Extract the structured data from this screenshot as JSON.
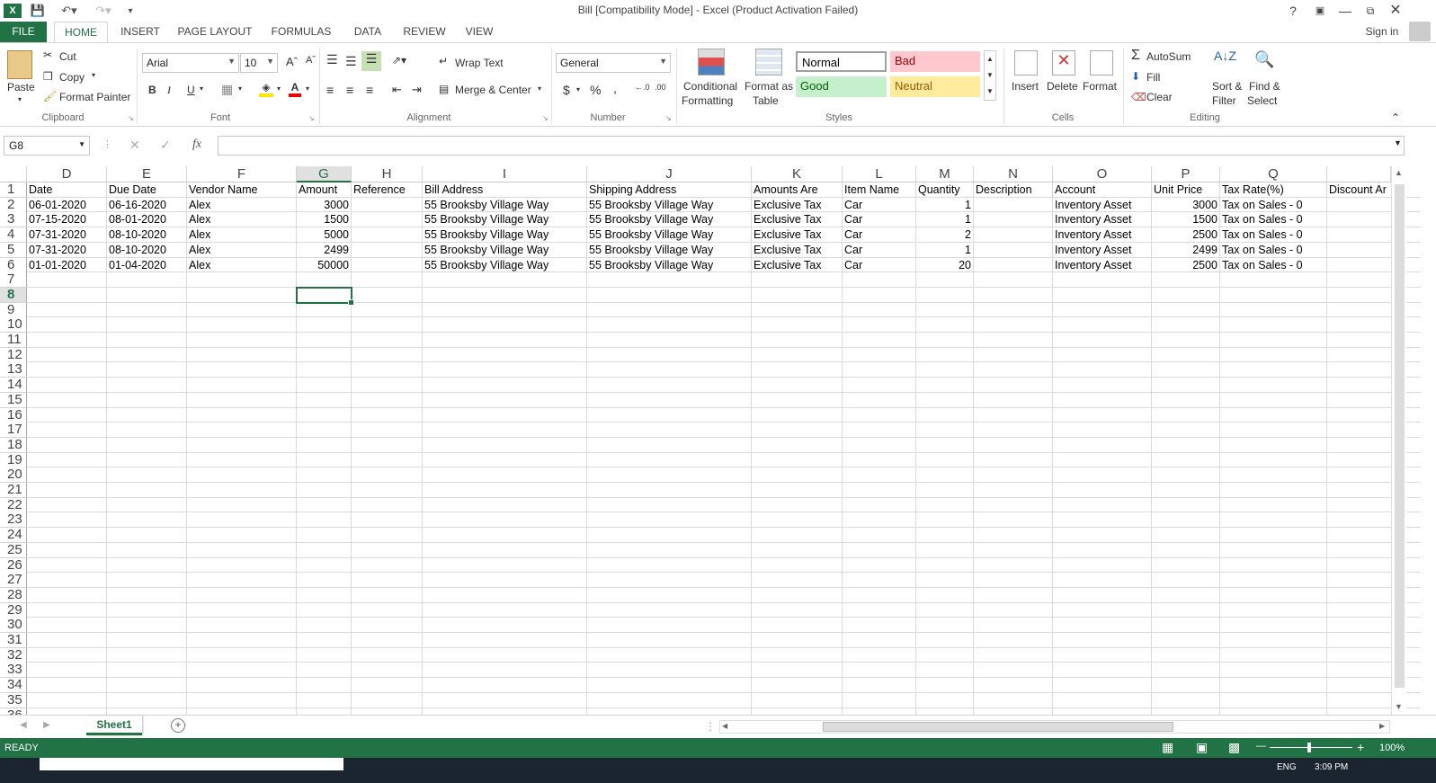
{
  "window": {
    "title": "Bill  [Compatibility Mode] - Excel (Product Activation Failed)",
    "help": "?",
    "sign_in": "Sign in"
  },
  "tabs": [
    "FILE",
    "HOME",
    "INSERT",
    "PAGE LAYOUT",
    "FORMULAS",
    "DATA",
    "REVIEW",
    "VIEW"
  ],
  "ribbon": {
    "clipboard": {
      "paste": "Paste",
      "cut": "Cut",
      "copy": "Copy",
      "format_painter": "Format Painter",
      "label": "Clipboard"
    },
    "font": {
      "name": "Arial",
      "size": "10",
      "label": "Font",
      "bold": "B",
      "italic": "I",
      "underline": "U"
    },
    "alignment": {
      "wrap_text": "Wrap Text",
      "merge_center": "Merge & Center",
      "label": "Alignment"
    },
    "number": {
      "format": "General",
      "currency": "$",
      "percent": "%",
      "comma": ",",
      "label": "Number"
    },
    "styles": {
      "conditional": "Conditional",
      "formatting": "Formatting",
      "format_as": "Format as",
      "table": "Table",
      "normal": "Normal",
      "bad": "Bad",
      "good": "Good",
      "neutral": "Neutral",
      "label": "Styles"
    },
    "cells": {
      "insert": "Insert",
      "delete": "Delete",
      "format": "Format",
      "label": "Cells"
    },
    "editing": {
      "autosum": "AutoSum",
      "fill": "Fill",
      "clear": "Clear",
      "sort": "Sort &",
      "filter": "Filter",
      "find": "Find &",
      "select": "Select",
      "label": "Editing"
    }
  },
  "formula_bar": {
    "name_box": "G8",
    "fx": "fx",
    "value": ""
  },
  "columns": [
    "D",
    "E",
    "F",
    "G",
    "H",
    "I",
    "J",
    "K",
    "L",
    "M",
    "N",
    "O",
    "P",
    "Q"
  ],
  "selected_column": "G",
  "selected_row": "8",
  "rows": [
    [
      "Date",
      "Due Date",
      "Vendor Name",
      "Amount",
      "Reference",
      "Bill Address",
      "Shipping Address",
      "Amounts Are",
      "Item Name",
      "Quantity",
      "Description",
      "Account",
      "Unit Price",
      "Tax Rate(%)",
      "Discount Ar"
    ],
    [
      "06-01-2020",
      "06-16-2020",
      "Alex",
      "3000",
      "",
      "55 Brooksby Village Way",
      "55 Brooksby Village Way",
      "Exclusive Tax",
      "Car",
      "1",
      "",
      "Inventory Asset",
      "3000",
      "Tax on Sales - 0",
      ""
    ],
    [
      "07-15-2020",
      "08-01-2020",
      "Alex",
      "1500",
      "",
      "55 Brooksby Village Way",
      "55 Brooksby Village Way",
      "Exclusive Tax",
      "Car",
      "1",
      "",
      "Inventory Asset",
      "1500",
      "Tax on Sales - 0",
      ""
    ],
    [
      "07-31-2020",
      "08-10-2020",
      "Alex",
      "5000",
      "",
      "55 Brooksby Village Way",
      "55 Brooksby Village Way",
      "Exclusive Tax",
      "Car",
      "2",
      "",
      "Inventory Asset",
      "2500",
      "Tax on Sales - 0",
      ""
    ],
    [
      "07-31-2020",
      "08-10-2020",
      "Alex",
      "2499",
      "",
      "55 Brooksby Village Way",
      "55 Brooksby Village Way",
      "Exclusive Tax",
      "Car",
      "1",
      "",
      "Inventory Asset",
      "2499",
      "Tax on Sales - 0",
      ""
    ],
    [
      "01-01-2020",
      "01-04-2020",
      "Alex",
      "50000",
      "",
      "55 Brooksby Village Way",
      "55 Brooksby Village Way",
      "Exclusive Tax",
      "Car",
      "20",
      "",
      "Inventory Asset",
      "2500",
      "Tax on Sales - 0",
      ""
    ]
  ],
  "numeric_cols": [
    3,
    9,
    12
  ],
  "row_count": 36,
  "sheets": [
    "Sheet1"
  ],
  "status": {
    "ready": "READY",
    "zoom": "100%"
  },
  "taskbar": {
    "lang": "ENG",
    "time": "3:09 PM"
  },
  "colors": {
    "accent": "#217346"
  }
}
